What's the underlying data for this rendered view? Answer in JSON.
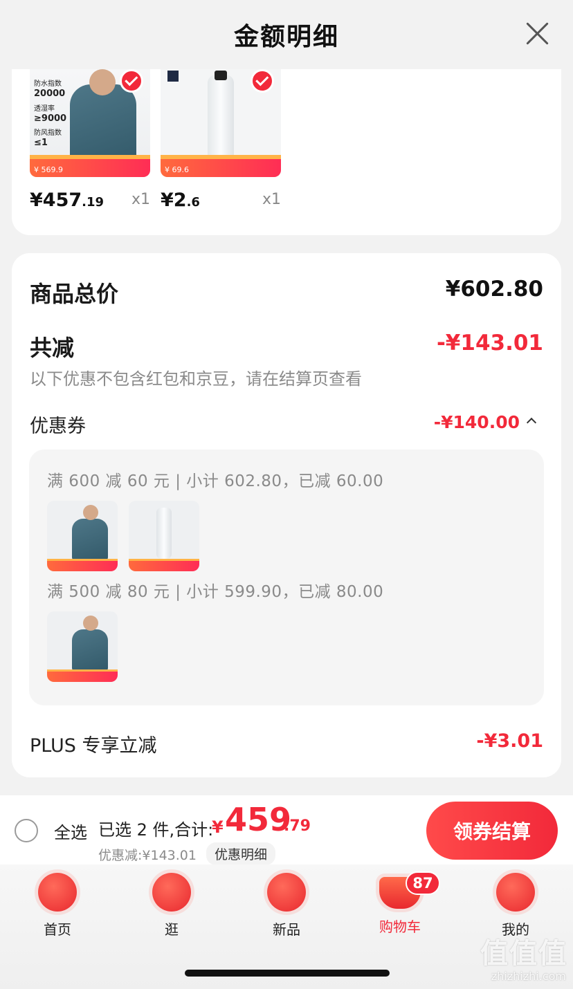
{
  "header": {
    "title": "金额明细"
  },
  "products": [
    {
      "price_big": "¥457",
      "price_small": ".19",
      "qty": "x1",
      "promo_price": "¥ 569.9",
      "spec_lines": [
        "防水指数",
        "20000",
        "透湿率",
        "≥9000",
        "防风指数",
        "≤1"
      ]
    },
    {
      "price_big": "¥2",
      "price_small": ".6",
      "qty": "x1",
      "promo_price": "¥ 69.6"
    }
  ],
  "summary": {
    "total_label": "商品总价",
    "total_value": "¥602.80",
    "reduce_label": "共减",
    "reduce_value": "-¥143.01",
    "note": "以下优惠不包含红包和京豆，请在结算页查看",
    "coupon_label": "优惠券",
    "coupon_value": "-¥140.00",
    "coupons": [
      {
        "rule": "满 600 减 60 元 | 小计 602.80，已减 60.00"
      },
      {
        "rule": "满 500 减 80 元 | 小计 599.90，已减 80.00"
      }
    ],
    "plus_label": "PLUS 专享立减",
    "plus_value": "-¥3.01"
  },
  "checkout": {
    "select_all": "全选",
    "selected_text": "已选 2 件,合计:",
    "sum_currency": "¥",
    "sum_big": "459",
    "sum_small": ".79",
    "discount_text": "优惠减:¥143.01",
    "detail_chip": "优惠明细",
    "checkout_button": "领券结算"
  },
  "tabbar": {
    "items": [
      {
        "label": "首页"
      },
      {
        "label": "逛"
      },
      {
        "label": "新品"
      },
      {
        "label": "购物车"
      },
      {
        "label": "我的"
      }
    ],
    "cart_badge": "87",
    "active": "购物车"
  },
  "watermark": {
    "text": "值值值",
    "url": "zhizhizhi.com"
  },
  "colors": {
    "accent": "#f2293a",
    "muted": "#8a8a8a",
    "background": "#f2f2f2"
  },
  "icons": [
    "close-icon",
    "check-icon",
    "chevron-up-icon",
    "home-icon",
    "explore-icon",
    "new-icon",
    "cart-icon",
    "user-icon"
  ]
}
